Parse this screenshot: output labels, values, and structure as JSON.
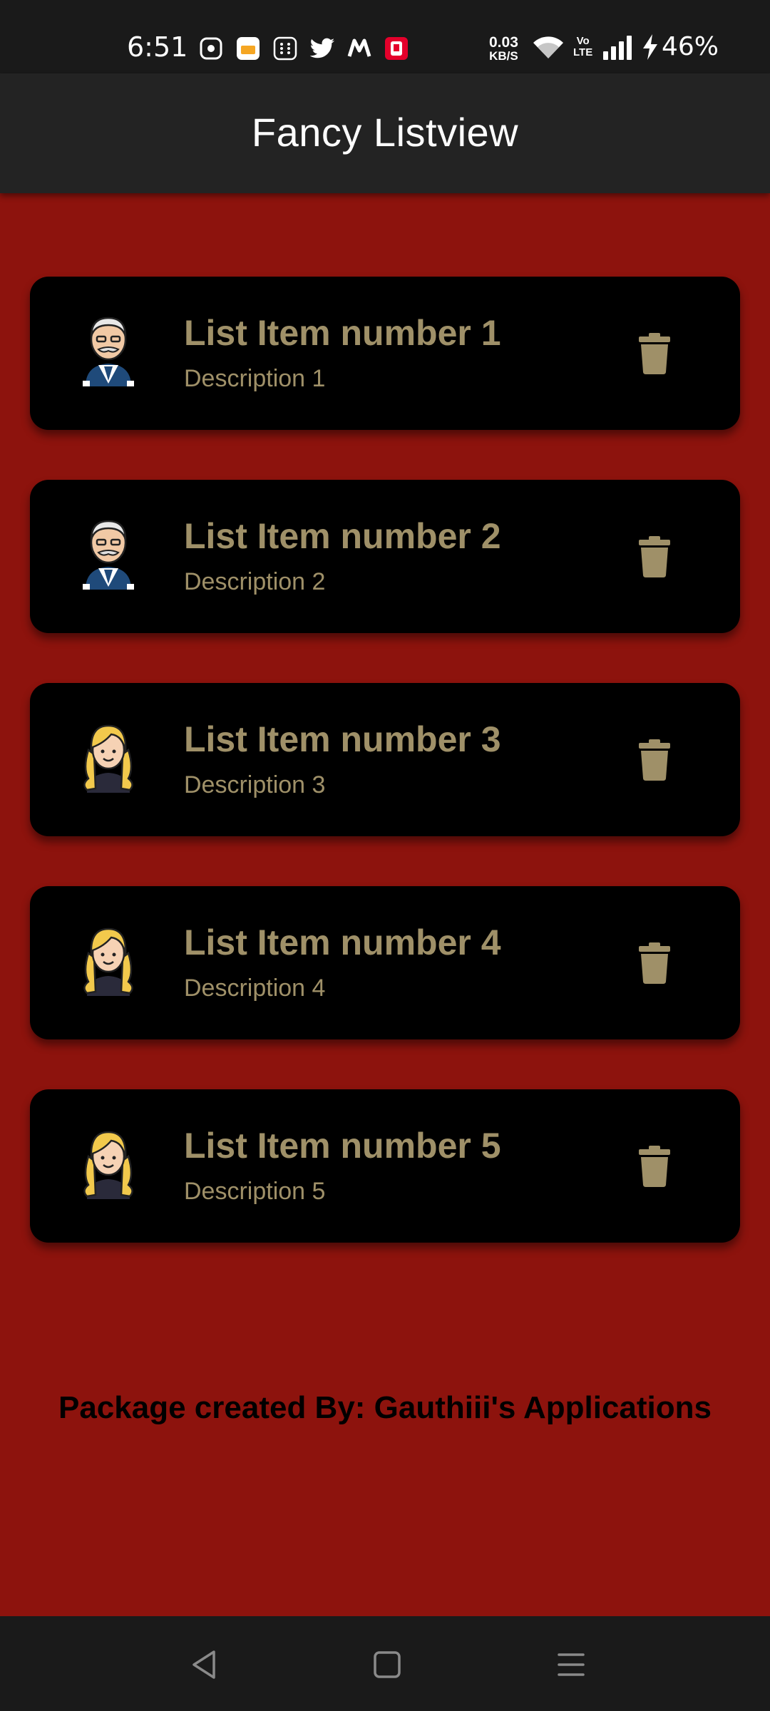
{
  "status_bar": {
    "time": "6:51",
    "net_speed_value": "0.03",
    "net_speed_unit": "KB/S",
    "volte_top": "Vo",
    "volte_bottom": "LTE",
    "battery": "46%",
    "notification_icons": [
      "screen-recorder-icon",
      "calendar-app-icon",
      "dialpad-app-icon",
      "twitter-icon",
      "myntra-icon",
      "kfc-icon"
    ]
  },
  "app_bar": {
    "title": "Fancy Listview"
  },
  "list": {
    "items": [
      {
        "title": "List Item number 1",
        "description": "Description 1",
        "avatar": "old-man-avatar-icon"
      },
      {
        "title": "List Item number 2",
        "description": "Description 2",
        "avatar": "old-man-avatar-icon"
      },
      {
        "title": "List Item number 3",
        "description": "Description 3",
        "avatar": "blonde-woman-avatar-icon"
      },
      {
        "title": "List Item number 4",
        "description": "Description 4",
        "avatar": "blonde-woman-avatar-icon"
      },
      {
        "title": "List Item number 5",
        "description": "Description 5",
        "avatar": "blonde-woman-avatar-icon"
      }
    ]
  },
  "footer": {
    "credit": "Package created By: Gauthiii's Applications"
  },
  "colors": {
    "background": "#8d130d",
    "app_bar": "#232323",
    "card": "#000000",
    "card_text": "#9f9068",
    "status_bar": "#1a1a1a"
  }
}
